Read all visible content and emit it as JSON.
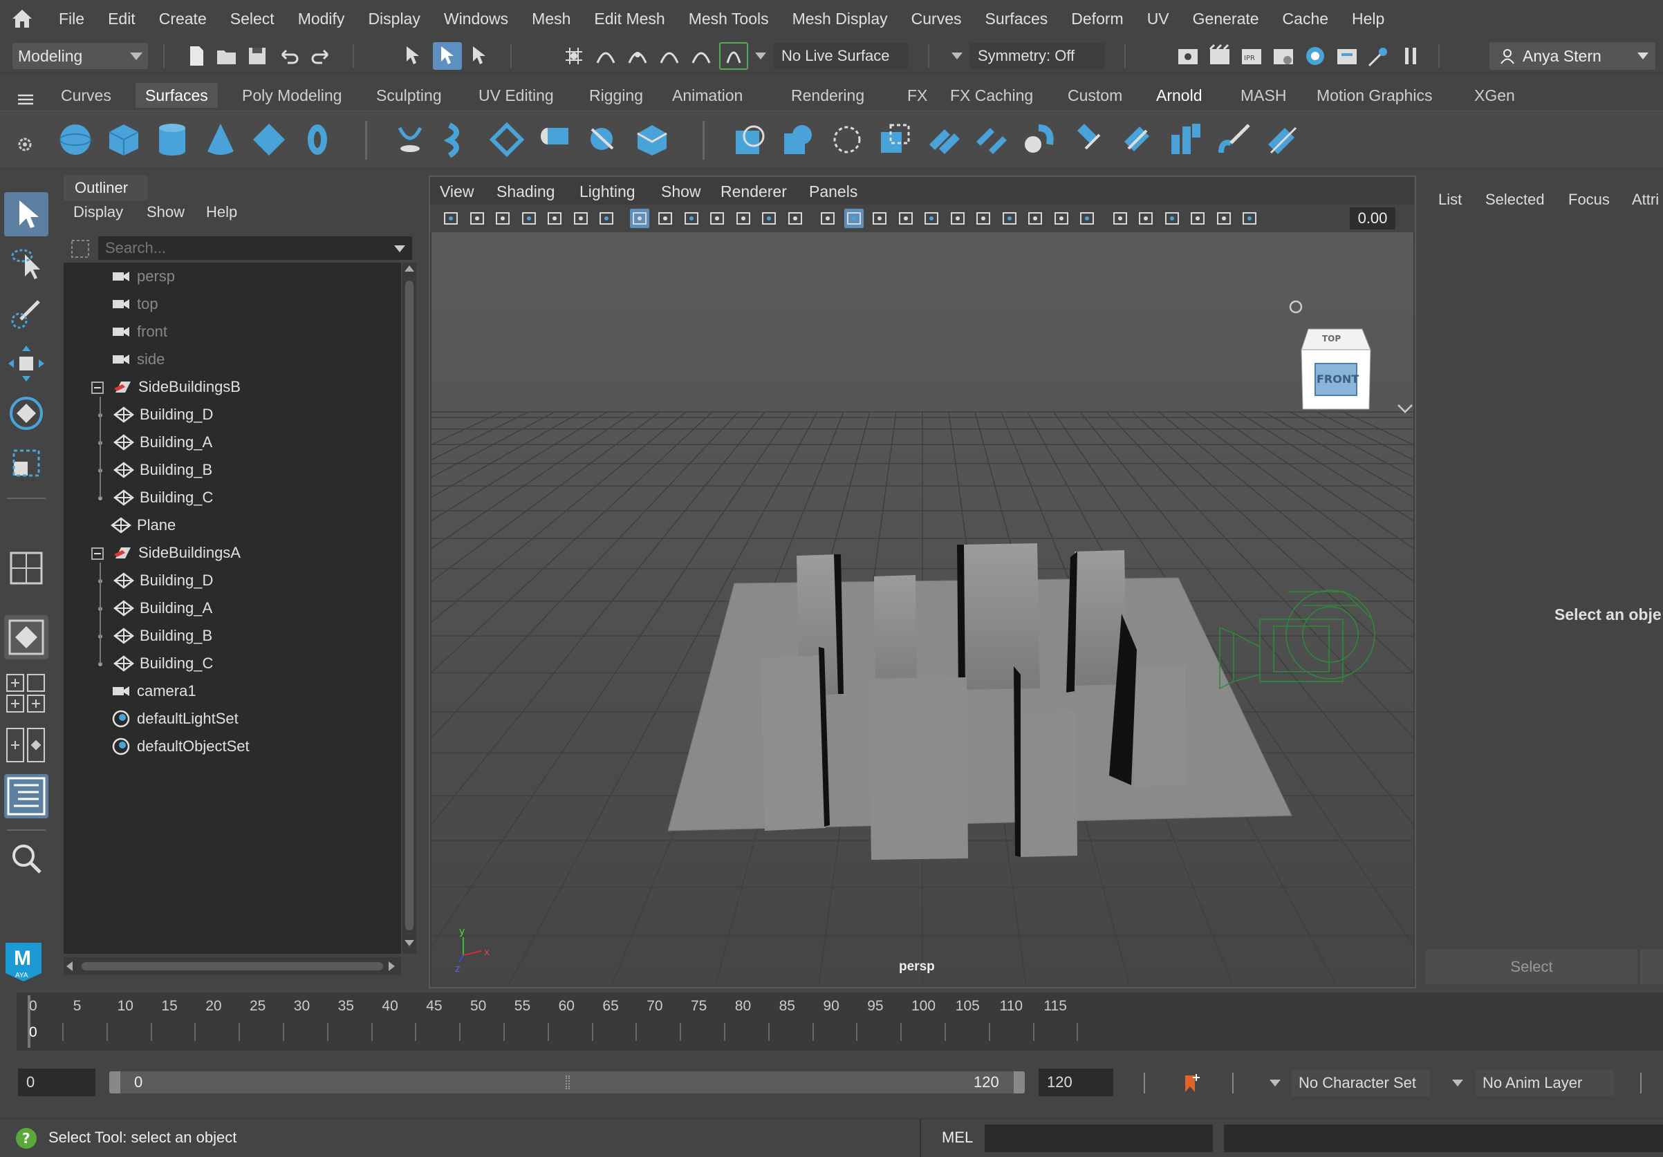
{
  "menubar": {
    "items": [
      "File",
      "Edit",
      "Create",
      "Select",
      "Modify",
      "Display",
      "Windows",
      "Mesh",
      "Edit Mesh",
      "Mesh Tools",
      "Mesh Display",
      "Curves",
      "Surfaces",
      "Deform",
      "UV",
      "Generate",
      "Cache",
      "Help"
    ]
  },
  "statusline": {
    "mode": "Modeling",
    "live_surface": "No Live Surface",
    "symmetry": "Symmetry: Off",
    "user": "Anya Stern"
  },
  "shelf": {
    "tabs": [
      "Curves",
      "Surfaces",
      "Poly Modeling",
      "Sculpting",
      "UV Editing",
      "Rigging",
      "Animation",
      "Rendering",
      "FX",
      "FX Caching",
      "Custom",
      "Arnold",
      "MASH",
      "Motion Graphics",
      "XGen"
    ],
    "active_tab": "Surfaces"
  },
  "outliner": {
    "title": "Outliner",
    "menu": [
      "Display",
      "Show",
      "Help"
    ],
    "search_placeholder": "Search...",
    "items": [
      {
        "label": "persp",
        "type": "camera",
        "depth": 0,
        "dim": true
      },
      {
        "label": "top",
        "type": "camera",
        "depth": 0,
        "dim": true
      },
      {
        "label": "front",
        "type": "camera",
        "depth": 0,
        "dim": true
      },
      {
        "label": "side",
        "type": "camera",
        "depth": 0,
        "dim": true
      },
      {
        "label": "SideBuildingsB",
        "type": "group",
        "depth": 0,
        "expanded": true
      },
      {
        "label": "Building_D",
        "type": "mesh",
        "depth": 1
      },
      {
        "label": "Building_A",
        "type": "mesh",
        "depth": 1
      },
      {
        "label": "Building_B",
        "type": "mesh",
        "depth": 1
      },
      {
        "label": "Building_C",
        "type": "mesh",
        "depth": 1
      },
      {
        "label": "Plane",
        "type": "mesh",
        "depth": 0
      },
      {
        "label": "SideBuildingsA",
        "type": "group",
        "depth": 0,
        "expanded": true
      },
      {
        "label": "Building_D",
        "type": "mesh",
        "depth": 1
      },
      {
        "label": "Building_A",
        "type": "mesh",
        "depth": 1
      },
      {
        "label": "Building_B",
        "type": "mesh",
        "depth": 1
      },
      {
        "label": "Building_C",
        "type": "mesh",
        "depth": 1
      },
      {
        "label": "camera1",
        "type": "camera",
        "depth": 0
      },
      {
        "label": "defaultLightSet",
        "type": "set",
        "depth": 0
      },
      {
        "label": "defaultObjectSet",
        "type": "set",
        "depth": 0
      }
    ]
  },
  "viewport": {
    "menu": [
      "View",
      "Shading",
      "Lighting",
      "Show",
      "Renderer",
      "Panels"
    ],
    "field_value": "0.00",
    "camera_label": "persp",
    "viewcube": {
      "top": "TOP",
      "front": "FRONT"
    },
    "axis": {
      "x": "x",
      "y": "y",
      "z": "z"
    }
  },
  "rightpanel": {
    "tabs": [
      "List",
      "Selected",
      "Focus",
      "Attri"
    ],
    "message": "Select an obje",
    "select_button": "Select"
  },
  "timeslider": {
    "ticks": [
      "0",
      "5",
      "10",
      "15",
      "20",
      "25",
      "30",
      "35",
      "40",
      "45",
      "50",
      "55",
      "60",
      "65",
      "70",
      "75",
      "80",
      "85",
      "90",
      "95",
      "100",
      "105",
      "110",
      "115"
    ],
    "current_frame": "0"
  },
  "range": {
    "start": "0",
    "inner_start": "0",
    "inner_end": "120",
    "end": "120",
    "character_set": "No Character Set",
    "anim_layer": "No Anim Layer"
  },
  "helpline": {
    "text": "Select Tool: select an object",
    "mel": "MEL"
  },
  "colors": {
    "accent": "#5d8fbf",
    "shelf_icon": "#4aa3d8",
    "background": "#444444"
  }
}
